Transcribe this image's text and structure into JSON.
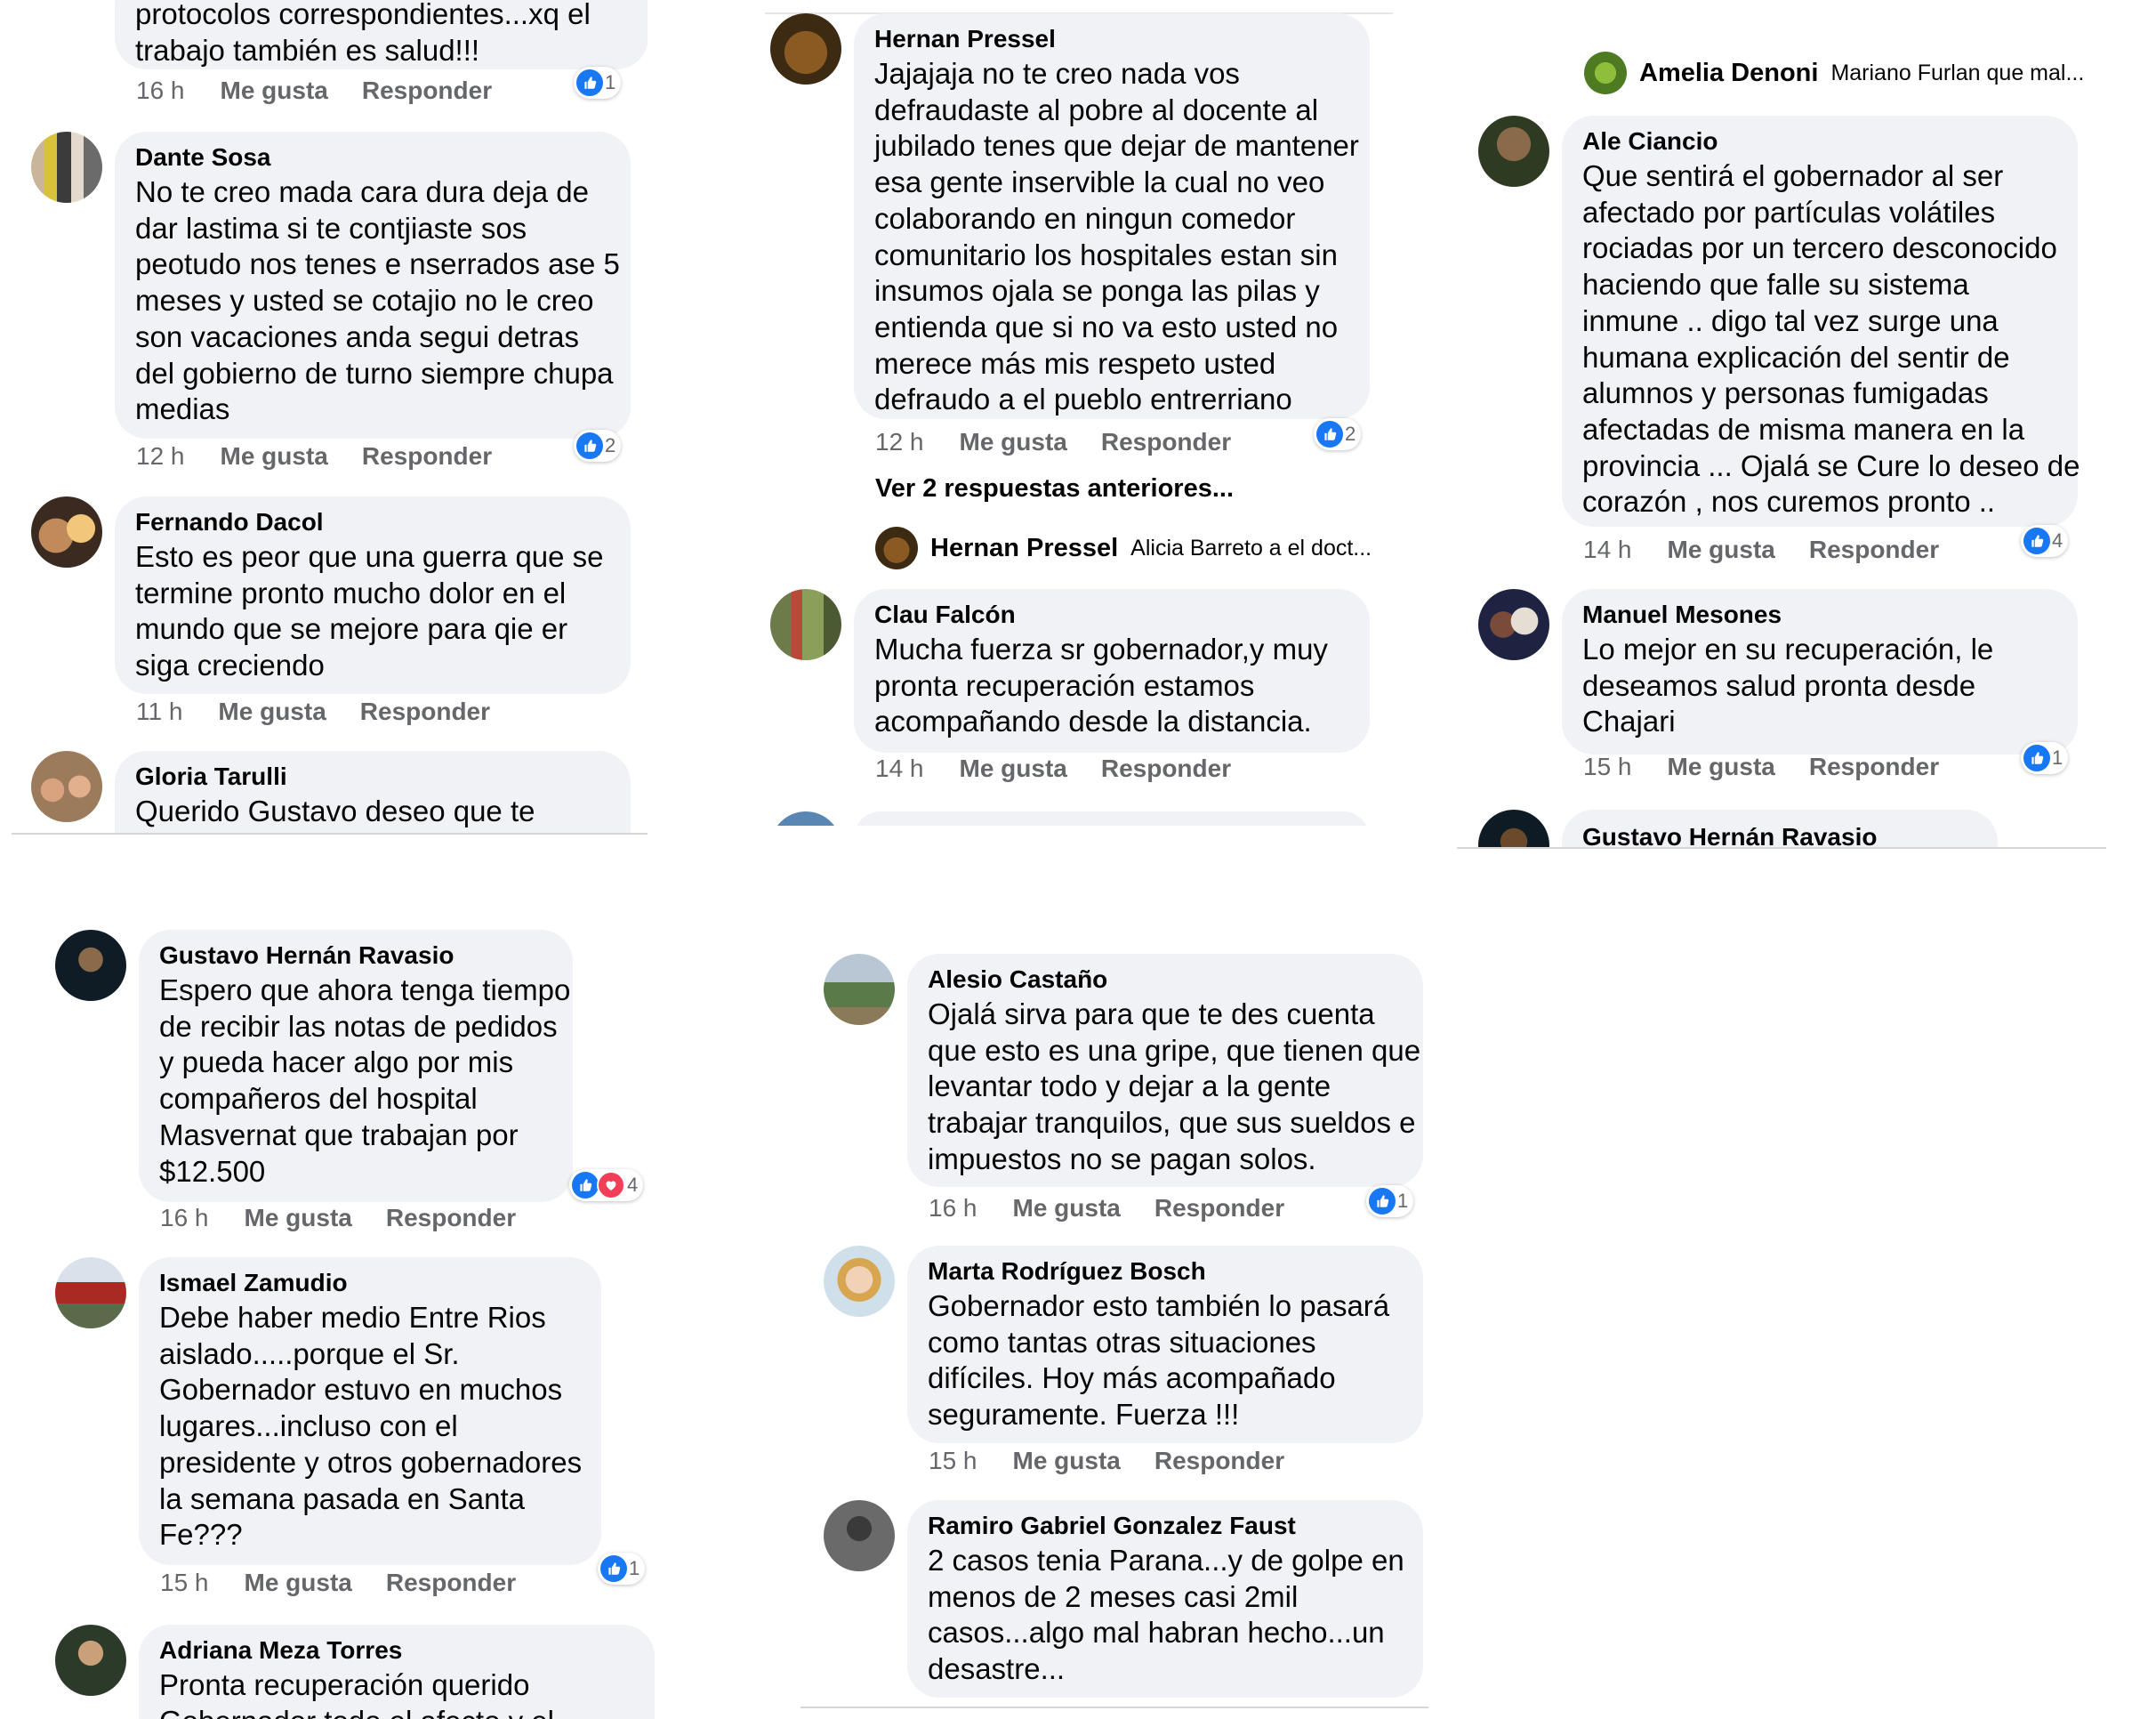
{
  "actions": {
    "like": "Me gusta",
    "reply": "Responder"
  },
  "icons": {
    "like": "thumbs-up-icon",
    "love": "heart-icon"
  },
  "colors": {
    "like_blue": "#1877f2",
    "love_red": "#f33e58",
    "bubble_bg": "#f0f2f5",
    "meta_gray": "#65676b"
  },
  "panel1": {
    "top_fragment": [
      "protocolos correspondientes...xq el",
      "trabajo también es salud!!!"
    ],
    "top_meta": {
      "time": "16 h",
      "reactions": "1"
    },
    "comments": [
      {
        "author": "Dante Sosa",
        "lines": [
          "No te creo mada cara dura deja de",
          "dar lastima si te contjiaste sos",
          "peotudo nos tenes e nserrados ase 5",
          "meses y usted se cotajio no le creo",
          "son vacaciones anda segui detras",
          "del gobierno de turno siempre chupa",
          "medias"
        ],
        "time": "12 h",
        "reactions": "2"
      },
      {
        "author": "Fernando Dacol",
        "lines": [
          "Esto es peor que una  guerra que se",
          "termine pronto  mucho dolor en el",
          "mundo  que se mejore  para qie er",
          "siga creciendo"
        ],
        "time": "11 h"
      },
      {
        "author": "Gloria Tarulli",
        "lines": [
          "Querido Gustavo deseo que te"
        ]
      }
    ]
  },
  "panel2": {
    "comments": [
      {
        "author": "Hernan Pressel",
        "lines": [
          "Jajajaja no te creo nada vos",
          "defraudaste al pobre al docente al",
          "jubilado tenes que dejar de mantener",
          "esa gente inservible la cual no veo",
          "colaborando en ningun comedor",
          "comunitario los hospitales estan sin",
          "insumos ojala se ponga las pilas y",
          "entienda que  si no va esto usted no",
          "merece  más mis respeto usted",
          "defraudo a el pueblo entrerriano"
        ],
        "time": "12 h",
        "reactions": "2"
      },
      {
        "author": "Clau Falcón",
        "lines": [
          "Mucha fuerza sr gobernador,y muy",
          "pronta recuperación estamos",
          "acompañando desde la distancia."
        ],
        "time": "14 h"
      }
    ],
    "more_replies": "Ver 2 respuestas anteriores...",
    "reply_preview": {
      "author": "Hernan Pressel",
      "text": "Alicia Barreto a el doct..."
    }
  },
  "panel3": {
    "reply_preview": {
      "author": "Amelia Denoni",
      "text": "Mariano Furlan que mal..."
    },
    "comments": [
      {
        "author": "Ale Ciancio",
        "lines": [
          "Que sentirá el gobernador al ser",
          "afectado por partículas volátiles",
          "rociadas por un tercero desconocido",
          "haciendo que falle su sistema",
          "inmune .. digo tal vez surge una",
          "humana explicación del sentir de",
          "alumnos y personas fumigadas",
          "afectadas de misma manera en la",
          "provincia ... Ojalá se Cure lo deseo de",
          "corazón ,  nos curemos pronto .."
        ],
        "time": "14 h",
        "reactions": "4"
      },
      {
        "author": "Manuel Mesones",
        "lines": [
          "Lo mejor  en su recuperación,  le",
          "deseamos salud pronta desde",
          "Chajari"
        ],
        "time": "15 h",
        "reactions": "1"
      },
      {
        "author": "Gustavo Hernán Ravasio",
        "lines": []
      }
    ]
  },
  "panel4": {
    "comments": [
      {
        "author": "Gustavo Hernán Ravasio",
        "lines": [
          "Espero que ahora tenga tiempo",
          "de recibir las notas de pedidos",
          "y pueda hacer algo por mis",
          "compañeros del hospital",
          "Masvernat que trabajan por",
          "$12.500"
        ],
        "time": "16 h",
        "reactions": "4"
      },
      {
        "author": "Ismael Zamudio",
        "lines": [
          "Debe haber medio Entre Rios",
          "aislado.....porque el Sr.",
          "Gobernador estuvo en muchos",
          "lugares...incluso con el",
          "presidente y otros gobernadores",
          "la semana pasada en Santa",
          "Fe???"
        ],
        "time": "15 h",
        "reactions": "1"
      },
      {
        "author": "Adriana Meza Torres",
        "lines": [
          "Pronta recuperación querido",
          "Gobernador  todo el afecto y el"
        ]
      }
    ]
  },
  "panel5": {
    "comments": [
      {
        "author": "Alesio Castaño",
        "lines": [
          "Ojalá sirva para que te des cuenta",
          "que esto es una gripe, que tienen que",
          "levantar todo y dejar a la gente",
          "trabajar tranquilos, que sus sueldos e",
          "impuestos no se pagan solos."
        ],
        "time": "16 h",
        "reactions": "1"
      },
      {
        "author": "Marta Rodríguez Bosch",
        "lines": [
          "Gobernador esto también lo pasará",
          "como tantas otras situaciones",
          "difíciles. Hoy más acompañado",
          "seguramente. Fuerza !!!"
        ],
        "time": "15 h"
      },
      {
        "author": "Ramiro Gabriel Gonzalez Faust",
        "lines": [
          "2 casos tenia Parana...y de golpe en",
          "menos de 2 meses casi 2mil",
          "casos...algo mal habran hecho...un",
          "desastre..."
        ]
      }
    ]
  }
}
